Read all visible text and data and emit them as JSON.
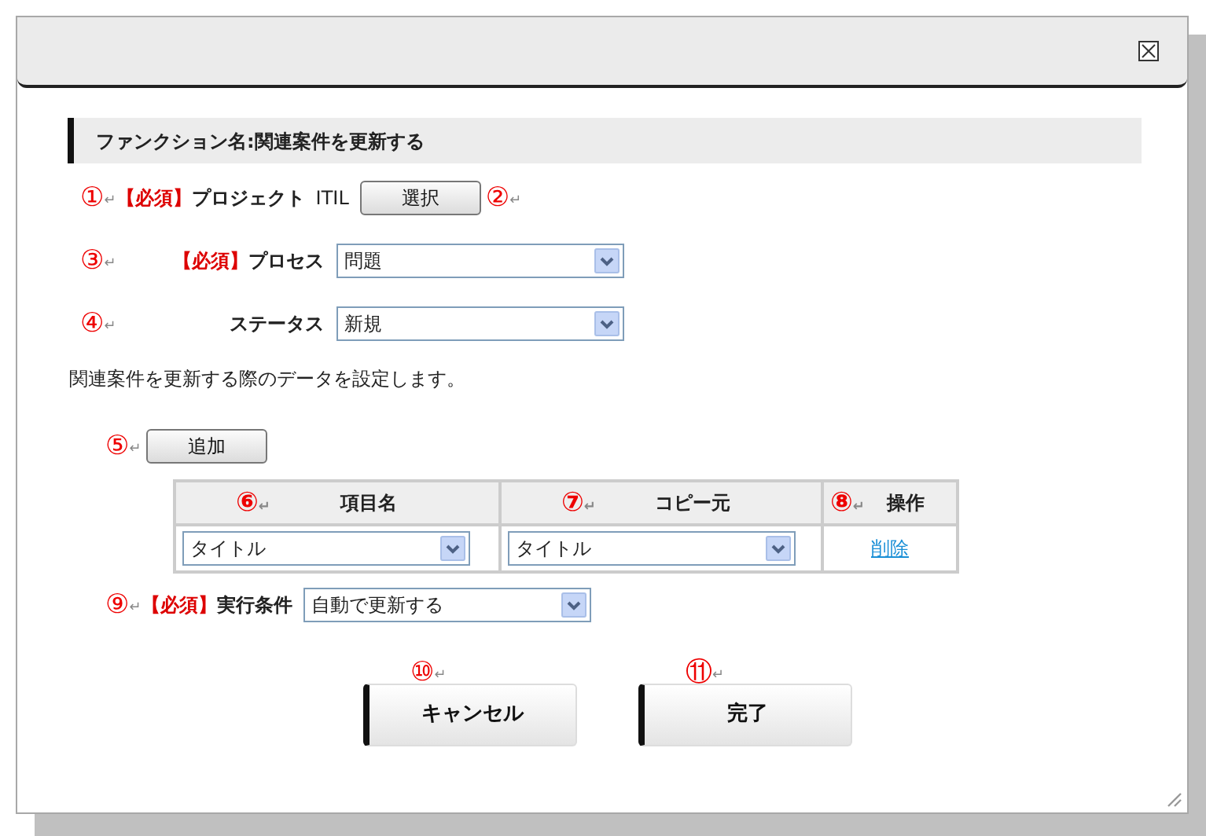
{
  "function_heading": "ファンクション名:関連案件を更新する",
  "fields": [
    {
      "kind": "picker",
      "annotation": {
        "number": "①",
        "return_mark": "↵"
      },
      "required_tag": "【必須】",
      "label": "プロジェクト",
      "value": "ITIL",
      "button": "選択",
      "trailing_annotation": {
        "number": "②",
        "return_mark": "↵"
      }
    },
    {
      "kind": "select",
      "annotation": {
        "number": "③",
        "return_mark": "↵"
      },
      "required_tag": "【必須】",
      "label": "プロセス",
      "value": "問題"
    },
    {
      "kind": "select",
      "annotation": {
        "number": "④",
        "return_mark": "↵"
      },
      "label": "ステータス",
      "value": "新規"
    }
  ],
  "description": "関連案件を更新する際のデータを設定します。",
  "add_button": {
    "annotation": {
      "number": "⑤",
      "return_mark": "↵"
    },
    "label": "追加"
  },
  "table": {
    "columns": [
      {
        "label": "項目名",
        "annotation": {
          "number": "⑥",
          "return_mark": "↵"
        }
      },
      {
        "label": "コピー元",
        "annotation": {
          "number": "⑦",
          "return_mark": "↵"
        }
      },
      {
        "label": "操作",
        "annotation": {
          "number": "⑧",
          "return_mark": "↵"
        }
      }
    ],
    "rows": [
      {
        "cells": [
          {
            "kind": "select",
            "value": "タイトル"
          },
          {
            "kind": "select",
            "value": "タイトル"
          },
          {
            "kind": "link",
            "text": "削除"
          }
        ]
      }
    ]
  },
  "condition": {
    "annotation": {
      "number": "⑨",
      "return_mark": "↵"
    },
    "required_tag": "【必須】",
    "label": "実行条件",
    "value": "自動で更新する"
  },
  "footer_buttons": [
    {
      "annotation": {
        "number": "⑩",
        "return_mark": "↵"
      },
      "label": "キャンセル"
    },
    {
      "annotation": {
        "number": "⑪",
        "return_mark": "↵"
      },
      "label": "完了"
    }
  ]
}
